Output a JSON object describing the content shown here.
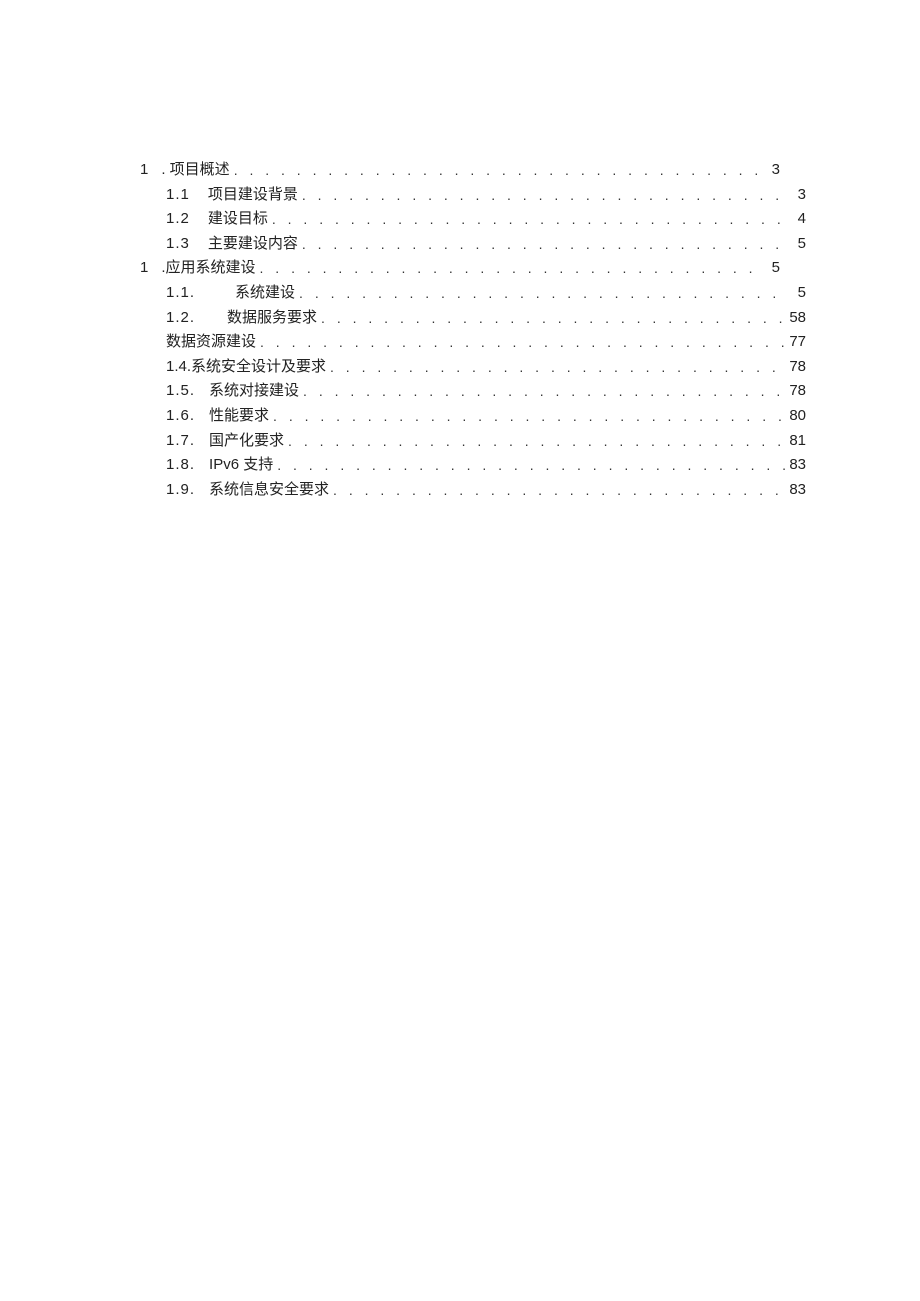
{
  "toc": [
    {
      "indent": 0,
      "num": "1",
      "gap": 12,
      "label": ". 项目概述",
      "page": "3"
    },
    {
      "indent": 1,
      "num": "1.1",
      "gap": 18,
      "label": "项目建设背景",
      "page": "3"
    },
    {
      "indent": 1,
      "num": "1.2",
      "gap": 18,
      "label": "建设目标",
      "page": "4"
    },
    {
      "indent": 1,
      "num": "1.3",
      "gap": 18,
      "label": "主要建设内容",
      "page": "5"
    },
    {
      "indent": 0,
      "num": "1",
      "gap": 12,
      "label": ".应用系统建设",
      "page": "5"
    },
    {
      "indent": 1,
      "num": "1.1.",
      "gap": 40,
      "label": "系统建设",
      "page": "5"
    },
    {
      "indent": 1,
      "num": "1.2.",
      "gap": 32,
      "label": "数据服务要求",
      "page": "58"
    },
    {
      "indent": 1,
      "num": "",
      "gap": 0,
      "label": "数据资源建设",
      "page": "77"
    },
    {
      "indent": 1,
      "num": "",
      "gap": 0,
      "label": "1.4.系统安全设计及要求",
      "page": "78"
    },
    {
      "indent": 1,
      "num": "1.5.",
      "gap": 14,
      "label": "系统对接建设",
      "page": "78"
    },
    {
      "indent": 1,
      "num": "1.6.",
      "gap": 14,
      "label": "性能要求",
      "page": "80"
    },
    {
      "indent": 1,
      "num": "1.7.",
      "gap": 14,
      "label": "国产化要求",
      "page": "81"
    },
    {
      "indent": 1,
      "num": "1.8.",
      "gap": 14,
      "label": "IPv6 支持",
      "page": "83"
    },
    {
      "indent": 1,
      "num": "1.9.",
      "gap": 14,
      "label": "系统信息安全要求",
      "page": "83"
    }
  ]
}
